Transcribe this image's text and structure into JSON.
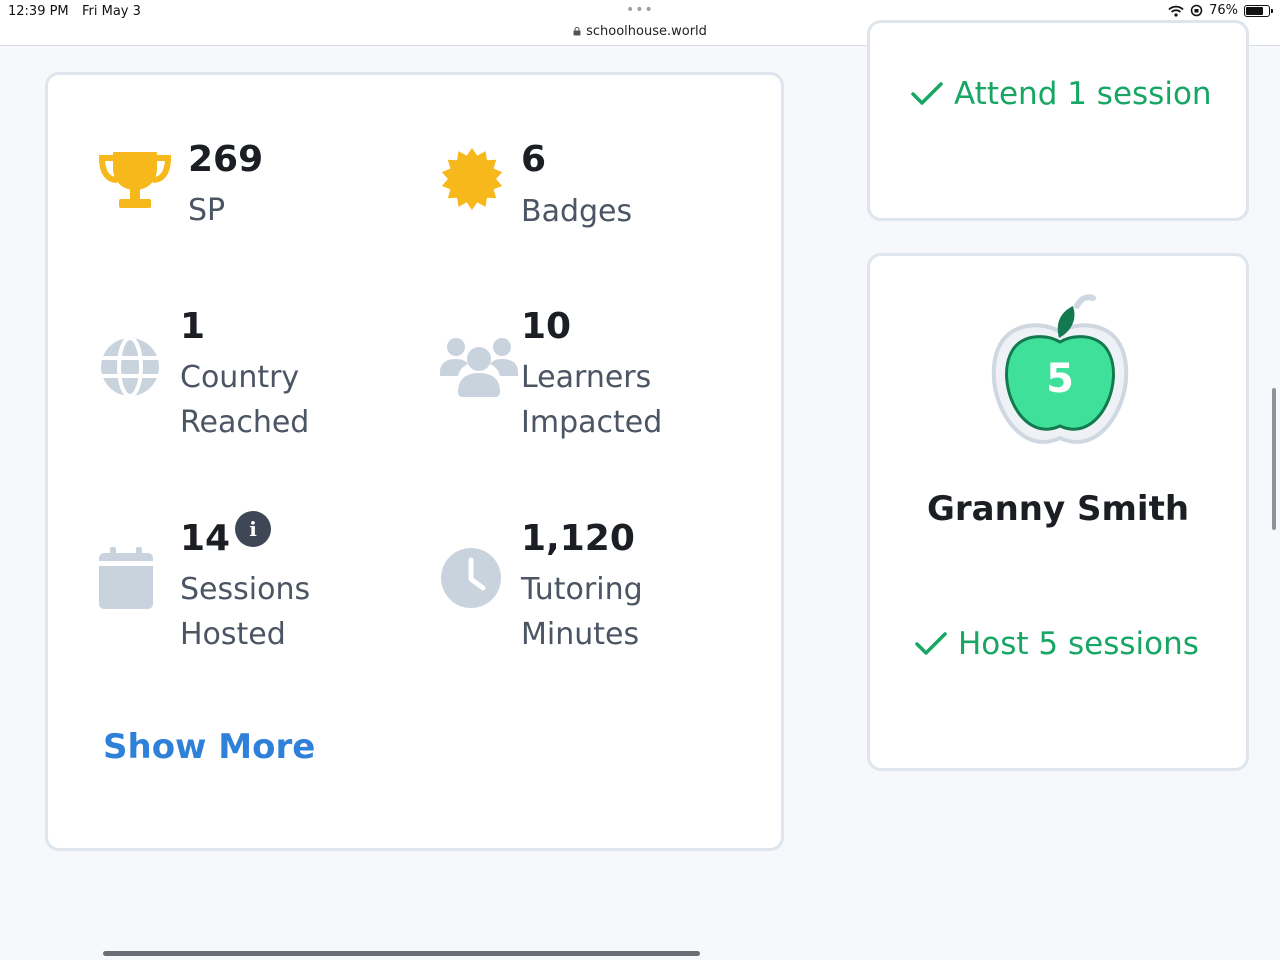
{
  "status_bar": {
    "time": "12:39 PM",
    "date": "Fri May 3",
    "url": "schoolhouse.world",
    "battery": "76%",
    "battery_level": 0.76
  },
  "stats": [
    {
      "value": "269",
      "label_lines": [
        "SP"
      ],
      "icon": "trophy-icon"
    },
    {
      "value": "6",
      "label_lines": [
        "Badges"
      ],
      "icon": "badge-seal-icon"
    },
    {
      "value": "1",
      "label_lines": [
        "Country",
        "Reached"
      ],
      "icon": "globe-icon"
    },
    {
      "value": "10",
      "label_lines": [
        "Learners",
        "Impacted"
      ],
      "icon": "people-icon"
    },
    {
      "value": "14",
      "label_lines": [
        "Sessions",
        "Hosted"
      ],
      "icon": "calendar-icon"
    },
    {
      "value": "1,120",
      "label_lines": [
        "Tutoring",
        "Minutes"
      ],
      "icon": "clock-icon"
    }
  ],
  "show_more_label": "Show More",
  "goals": {
    "top": {
      "check_text": "Attend 1 session"
    },
    "badge": {
      "number": "5",
      "name": "Granny Smith",
      "check_text": "Host 5 sessions"
    }
  },
  "colors": {
    "accent_blue": "#2f80d9",
    "success_green": "#18a665",
    "trophy_gold": "#f7b81b",
    "apple_green": "#3fe09a",
    "icon_gray": "#c9d3de"
  }
}
